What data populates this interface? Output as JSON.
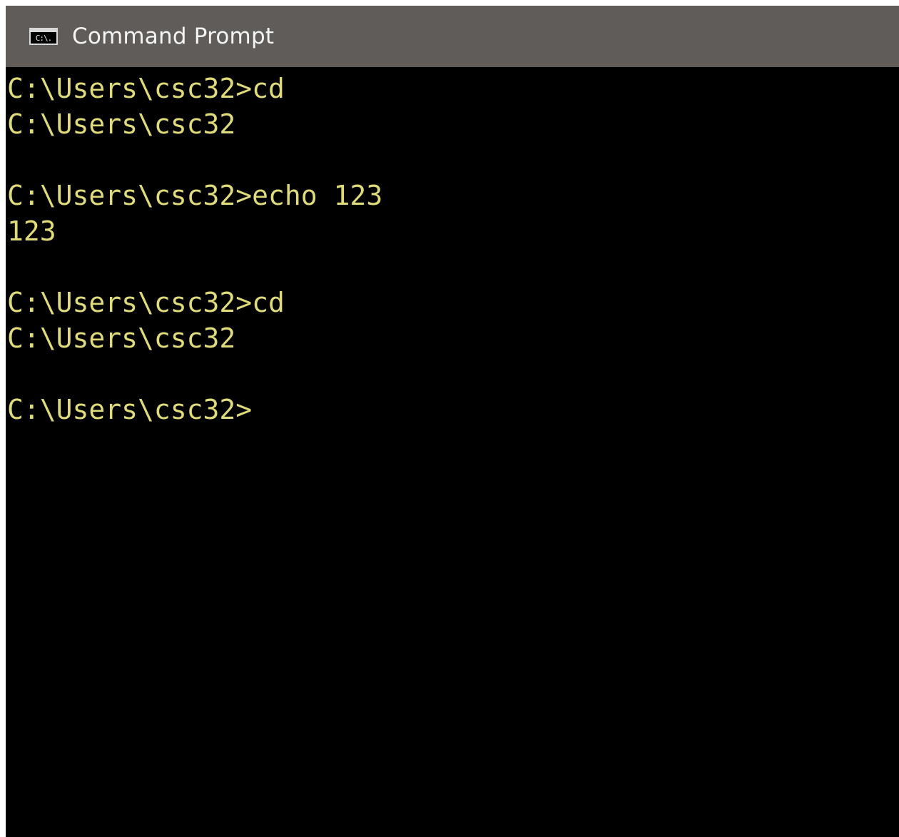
{
  "window": {
    "title": "Command Prompt",
    "icon": "cmd-console-icon",
    "icon_glyph": "C:\\."
  },
  "colors": {
    "titlebar": "#5f5c59",
    "console_bg": "#000000",
    "console_text": "#e0db7a"
  },
  "console": {
    "lines": [
      "C:\\Users\\csc32>cd",
      "C:\\Users\\csc32",
      "",
      "C:\\Users\\csc32>echo 123",
      "123",
      "",
      "C:\\Users\\csc32>cd",
      "C:\\Users\\csc32",
      "",
      "C:\\Users\\csc32>"
    ]
  }
}
